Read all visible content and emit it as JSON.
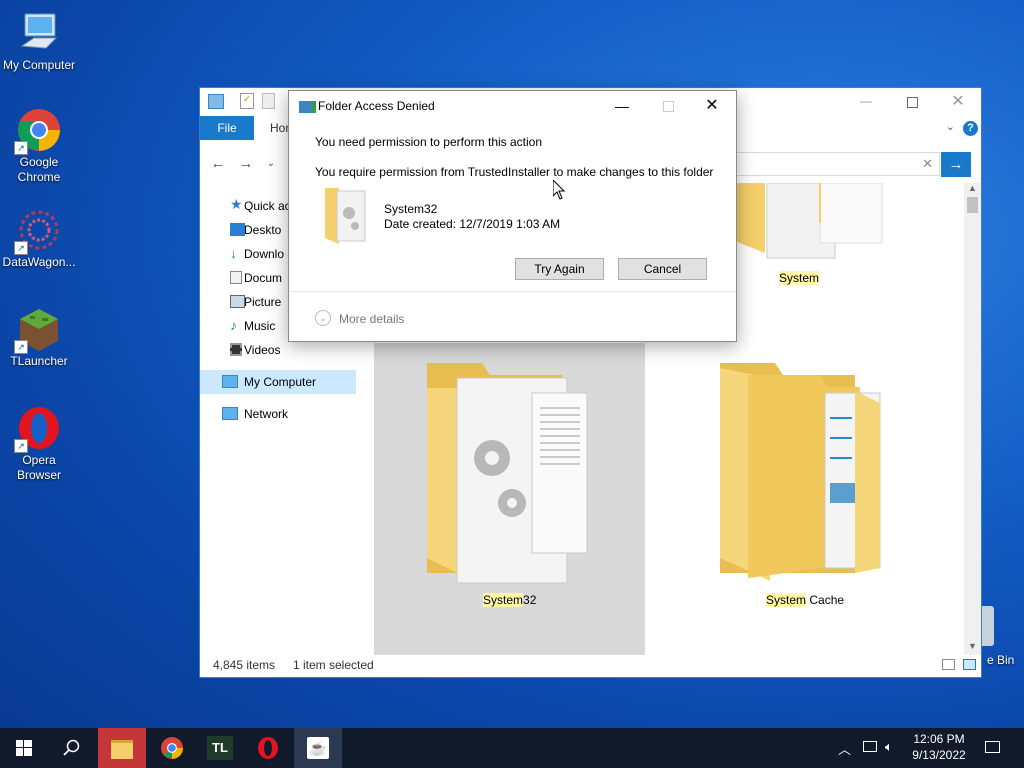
{
  "desktop": {
    "icons": [
      {
        "label": "My Computer"
      },
      {
        "label": "Google Chrome"
      },
      {
        "label": "DataWagon..."
      },
      {
        "label": "TLauncher"
      },
      {
        "label": "Opera Browser"
      }
    ],
    "recycle_bin_label": "e Bin"
  },
  "explorer": {
    "ribbon": {
      "file_tab": "File",
      "home_tab": "Hon"
    },
    "sidebar": [
      {
        "label": "Quick ac",
        "icon": "star-icon"
      },
      {
        "label": "Deskto",
        "icon": "desktop-icon"
      },
      {
        "label": "Downlo",
        "icon": "download-icon"
      },
      {
        "label": "Docum",
        "icon": "document-icon"
      },
      {
        "label": "Picture",
        "icon": "picture-icon"
      },
      {
        "label": "Music",
        "icon": "music-icon"
      },
      {
        "label": "Videos",
        "icon": "video-icon"
      },
      {
        "label": "My Computer",
        "icon": "computer-icon"
      },
      {
        "label": "Network",
        "icon": "network-icon"
      }
    ],
    "folders": [
      {
        "name": "System",
        "highlight": "System",
        "rest": ""
      },
      {
        "name": "System32",
        "highlight": "System",
        "rest": "32"
      },
      {
        "name": "System Cache",
        "highlight": "System",
        "rest": " Cache"
      }
    ],
    "status": {
      "items": "4,845 items",
      "selected": "1 item selected"
    }
  },
  "dialog": {
    "title": "Folder Access Denied",
    "message": "You need permission to perform this action",
    "detail": "You require permission from TrustedInstaller to make changes to this folder",
    "item_name": "System32",
    "item_date": "Date created: 12/7/2019 1:03 AM",
    "try_again": "Try Again",
    "cancel": "Cancel",
    "more_details": "More details"
  },
  "taskbar": {
    "time": "12:06 PM",
    "date": "9/13/2022",
    "tl_label": "TL"
  },
  "colors": {
    "accent": "#1979ca",
    "highlight": "#fff6a6",
    "selected": "#d9d9d9"
  }
}
